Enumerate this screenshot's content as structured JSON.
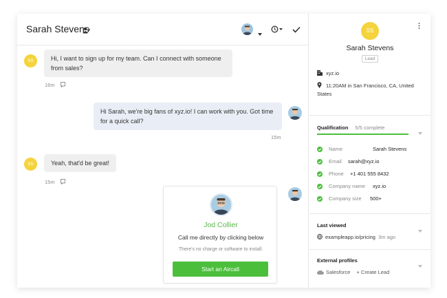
{
  "chat": {
    "title": "Sarah Stevens",
    "messages": [
      {
        "from": "visitor",
        "initials": "SS",
        "text": "Hi, I want to sign up for my team. Can I connect with someone from sales?",
        "time": "16m"
      },
      {
        "from": "agent",
        "text": "Hi Sarah, we're big fans of xyz.io! I can work with you. Got time for a quick call?",
        "time": "15m"
      },
      {
        "from": "visitor",
        "initials": "SS",
        "text": "Yeah, that'd be great!",
        "time": "15m"
      }
    ],
    "card": {
      "name": "Jod Collier",
      "subtitle": "Call me directly by clicking below",
      "note": "There's no charge or software to install.",
      "button": "Start an Aircall"
    }
  },
  "side": {
    "initials": "SS",
    "name": "Sarah Stevens",
    "badge": "Lead",
    "company": "xyz.io",
    "location": "11:20AM in San Francisco, CA, United States",
    "qualification": {
      "title": "Qualification",
      "progress_text": "5/5 complete",
      "progress": 1.0,
      "rows": [
        {
          "label": "Name",
          "value": "Sarah Stevens"
        },
        {
          "label": "Email",
          "value": "sarah@xyz.io"
        },
        {
          "label": "Phone",
          "value": "+1 401 555 8432"
        },
        {
          "label": "Company name",
          "value": "xyz.io"
        },
        {
          "label": "Company size",
          "value": "500+"
        }
      ]
    },
    "last_viewed": {
      "title": "Last viewed",
      "page": "exampleapp.io/pricing",
      "time": "3m ago"
    },
    "external_profiles": {
      "title": "External profiles",
      "salesforce": "Salesforce",
      "create_lead": "+ Create Lead"
    }
  },
  "colors": {
    "accent_green": "#4bbf3c",
    "visitor_avatar": "#f5d33c",
    "agent_bubble": "#e9eef6",
    "visitor_bubble": "#efefef"
  }
}
